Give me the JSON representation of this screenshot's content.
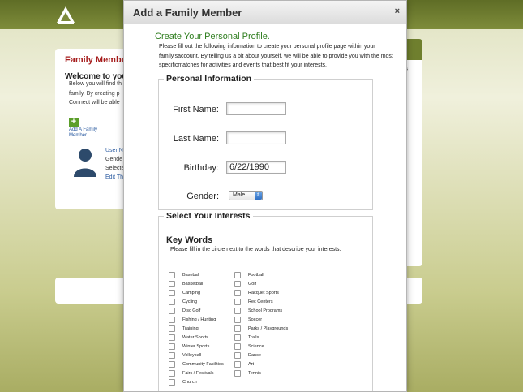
{
  "background": {
    "family_member_title": "Family Member",
    "welcome": "Welcome to you",
    "lines": [
      "Below you will find th",
      "family. By creating p",
      "Connect will be able"
    ],
    "add_label": "Add A Family Member",
    "user_lines": [
      "User N",
      "Gende",
      "Selecte",
      "Edit Th"
    ],
    "right_letter": "s"
  },
  "modal": {
    "title": "Add a Family Member",
    "close_symbol": "×",
    "profile_title": "Create Your Personal Profile.",
    "intro_text": "Please fill out the following information to create your personal profile page within your family'saccount. By telling us a bit about yourself, we will be able to provide you with the most specificmatches for activities and events that best fit your interests.",
    "personal": {
      "legend": "Personal Information",
      "first_name_label": "First Name:",
      "first_name_value": "",
      "last_name_label": "Last Name:",
      "last_name_value": "",
      "birthday_label": "Birthday:",
      "birthday_value": "6/22/1990",
      "gender_label": "Gender:",
      "gender_value": "Male"
    },
    "interests": {
      "legend": "Select Your Interests",
      "keywords_title": "Key Words",
      "keywords_sub": "Please fill in the circle next to the words that describe your interests:",
      "col1": [
        "Baseball",
        "Basketball",
        "Camping",
        "Cycling",
        "Disc Golf",
        "Fishing / Hunting",
        "Training",
        "Water Sports",
        "Winter Sports",
        "Volleyball",
        "Community Facilities",
        "Fairs / Festivals",
        "Church"
      ],
      "col2": [
        "Football",
        "Golf",
        "Racquet Sports",
        "Rec Centers",
        "School Programs",
        "Soccer",
        "Parks / Playgrounds",
        "Trails",
        "Science",
        "Dance",
        "Art",
        "Tennis"
      ]
    }
  },
  "colors": {
    "header_olive": "#7d8a3c",
    "title_green": "#2e7d1e",
    "title_red": "#a61d1d"
  }
}
